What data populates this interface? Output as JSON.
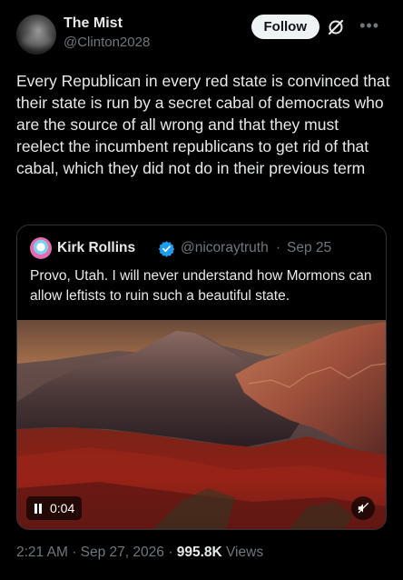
{
  "author": {
    "name": "The Mist",
    "handle": "@Clinton2028"
  },
  "actions": {
    "follow_label": "Follow",
    "grok_icon": "grok-icon",
    "more_icon": "more-icon"
  },
  "tweet": {
    "text": "Every Republican in every red state is convinced that their state is run by a secret cabal of democrats who are the source of all wrong and that they must reelect the incumbent republicans to get rid of that cabal, which they did not do in their previous term"
  },
  "quote": {
    "name": "Kirk Rollins",
    "handle": "@nicoraytruth",
    "separator": "·",
    "date": "Sep 25",
    "text": "Provo, Utah. I will never understand how Mormons can allow leftists to ruin such a beautiful state.",
    "video": {
      "time": "0:04",
      "pause_icon": "pause-icon",
      "mute_icon": "mute-icon"
    }
  },
  "meta": {
    "time": "2:21 AM",
    "separator": "·",
    "date": "Sep 27, 2026",
    "views_count": "995.8K",
    "views_label": "Views"
  },
  "colors": {
    "background": "#000000",
    "text": "#e7e9ea",
    "secondary": "#71767b",
    "verified": "#1d9bf0",
    "border": "#2f3336"
  }
}
